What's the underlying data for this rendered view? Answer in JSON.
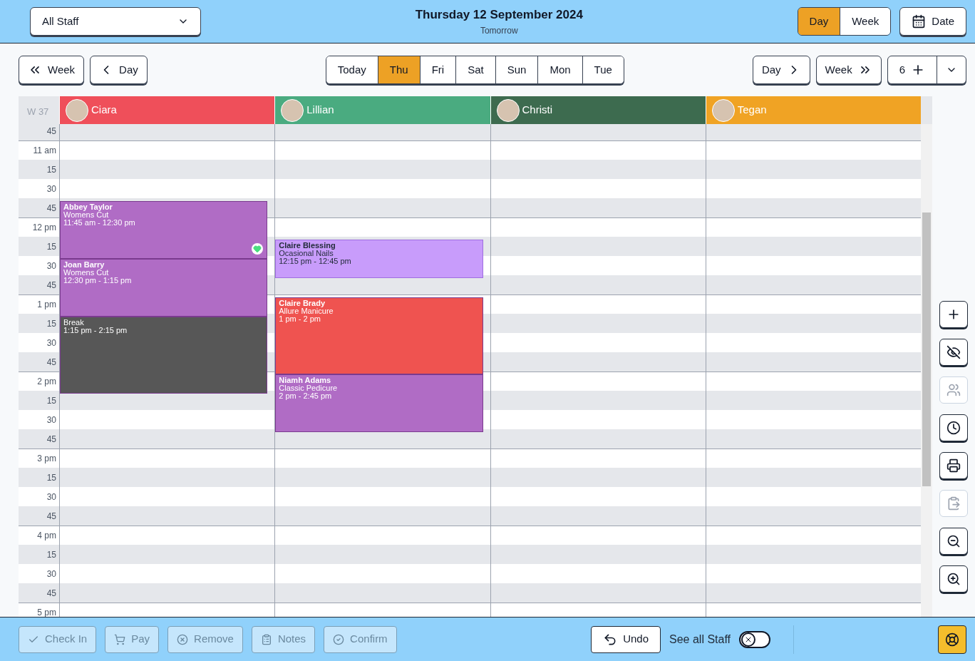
{
  "staff_filter": {
    "value": "All Staff"
  },
  "date_title": "Thursday 12 September 2024",
  "date_subtitle": "Tomorrow",
  "view_toggle": [
    {
      "label": "Day",
      "selected": true
    },
    {
      "label": "Week",
      "selected": false
    }
  ],
  "date_button": "Date",
  "nav_back": [
    {
      "label": "Week",
      "kind": "double"
    },
    {
      "label": "Day",
      "kind": "single"
    }
  ],
  "day_tabs": [
    {
      "label": "Today",
      "selected": false
    },
    {
      "label": "Thu",
      "selected": true
    },
    {
      "label": "Fri",
      "selected": false
    },
    {
      "label": "Sat",
      "selected": false
    },
    {
      "label": "Sun",
      "selected": false
    },
    {
      "label": "Mon",
      "selected": false
    },
    {
      "label": "Tue",
      "selected": false
    }
  ],
  "nav_forward": [
    {
      "label": "Day",
      "kind": "single"
    },
    {
      "label": "Week",
      "kind": "double"
    }
  ],
  "columns_count": "6",
  "week_label": "W 37",
  "time_slots": [
    "45",
    "11 am",
    "15",
    "30",
    "45",
    "12 pm",
    "15",
    "30",
    "45",
    "1 pm",
    "15",
    "30",
    "45",
    "2 pm",
    "15",
    "30",
    "45",
    "3 pm",
    "15",
    "30",
    "45",
    "4 pm",
    "15",
    "30",
    "45",
    "5 pm"
  ],
  "staff": [
    {
      "name": "Ciara",
      "color": "#ef4f5a",
      "events": [
        {
          "kind": "appointment",
          "client": "Abbey Taylor",
          "service": "Womens Cut",
          "time": "11:45 am - 12:30 pm",
          "color": "#b06cc5",
          "dark_text": false,
          "heart": true
        },
        {
          "kind": "appointment",
          "client": "Joan Barry",
          "service": "Womens Cut",
          "time": "12:30 pm - 1:15 pm",
          "color": "#b06cc5",
          "dark_text": false,
          "heart": false
        },
        {
          "kind": "break",
          "client": "Break",
          "time": "1:15 pm - 2:15 pm",
          "color": "#575757",
          "dark_text": false,
          "heart": false
        }
      ]
    },
    {
      "name": "Lillian",
      "color": "#4aab80",
      "events": [
        {
          "kind": "appointment",
          "client": "Claire Blessing",
          "service": "Ocasional Nails",
          "time": "12:15 pm - 12:45 pm",
          "color": "#c89cfb",
          "dark_text": true,
          "heart": false
        },
        {
          "kind": "appointment",
          "client": "Claire Brady",
          "service": "Allure Manicure",
          "time": "1 pm - 2 pm",
          "color": "#ef5350",
          "dark_text": false,
          "heart": false
        },
        {
          "kind": "appointment",
          "client": "Niamh Adams",
          "service": "Classic Pedicure",
          "time": "2 pm - 2:45 pm",
          "color": "#b06cc5",
          "dark_text": false,
          "heart": false
        }
      ]
    },
    {
      "name": "Christi",
      "color": "#3d6b4f"
    },
    {
      "name": "Tegan",
      "color": "#f0a324"
    }
  ],
  "side_tools": [
    {
      "kind": "add",
      "disabled": false
    },
    {
      "kind": "hide",
      "disabled": false
    },
    {
      "kind": "group",
      "disabled": true
    },
    {
      "kind": "clock",
      "disabled": false
    },
    {
      "kind": "print",
      "disabled": false
    },
    {
      "kind": "paste",
      "disabled": true
    },
    {
      "kind": "zoom-out",
      "disabled": false
    },
    {
      "kind": "zoom-in",
      "disabled": false
    }
  ],
  "actions": [
    {
      "kind": "check",
      "label": "Check In",
      "disabled": true
    },
    {
      "kind": "cart",
      "label": "Pay",
      "disabled": true
    },
    {
      "kind": "remove",
      "label": "Remove",
      "disabled": true
    },
    {
      "kind": "notes",
      "label": "Notes",
      "disabled": true
    },
    {
      "kind": "confirm",
      "label": "Confirm",
      "disabled": true
    }
  ],
  "undo": "Undo",
  "see_all_staff": {
    "label": "See all Staff",
    "on": false
  }
}
